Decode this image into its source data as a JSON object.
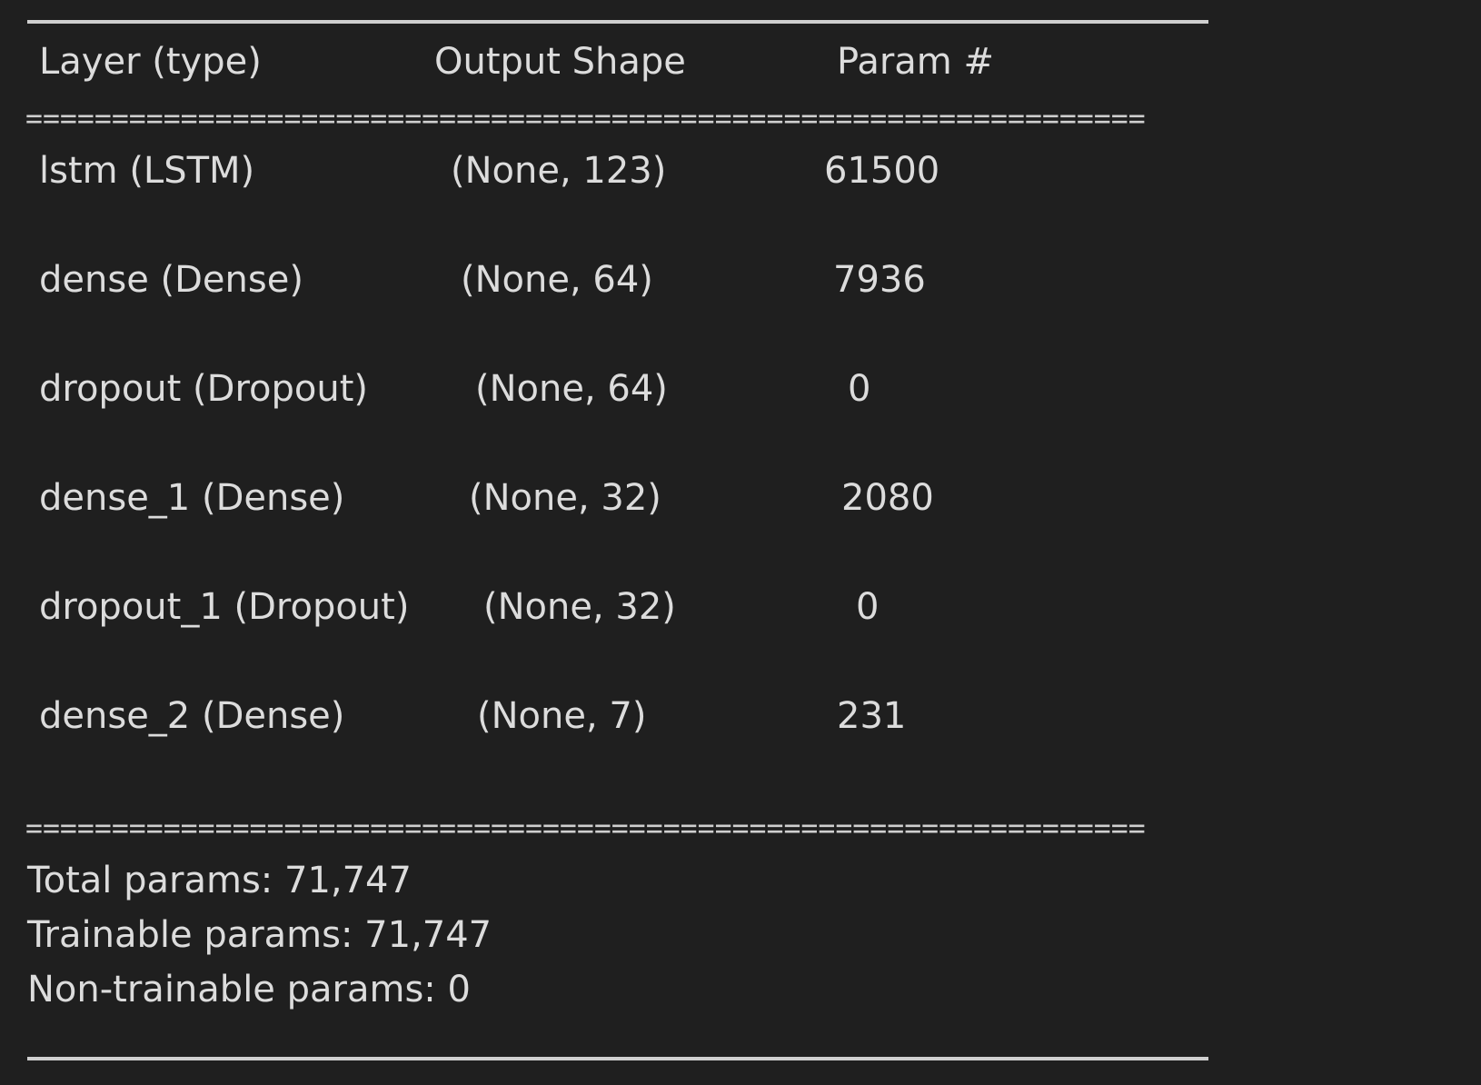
{
  "summary": {
    "headers": {
      "layer": "Layer (type)",
      "shape": "Output Shape",
      "params": "Param #"
    },
    "equals_rule": "=================================================================",
    "rows": [
      {
        "layer": "lstm (LSTM)",
        "shape": "(None, 123)",
        "params": "61500"
      },
      {
        "layer": "dense (Dense)",
        "shape": "(None, 64)",
        "params": "7936"
      },
      {
        "layer": "dropout (Dropout)",
        "shape": "(None, 64)",
        "params": "0"
      },
      {
        "layer": "dense_1 (Dense)",
        "shape": "(None, 32)",
        "params": "2080"
      },
      {
        "layer": "dropout_1 (Dropout)",
        "shape": "(None, 32)",
        "params": "0"
      },
      {
        "layer": "dense_2 (Dense)",
        "shape": "(None, 7)",
        "params": "231"
      }
    ],
    "totals": {
      "total": "Total params: 71,747",
      "trainable": "Trainable params: 71,747",
      "non_trainable": "Non-trainable params: 0"
    }
  }
}
